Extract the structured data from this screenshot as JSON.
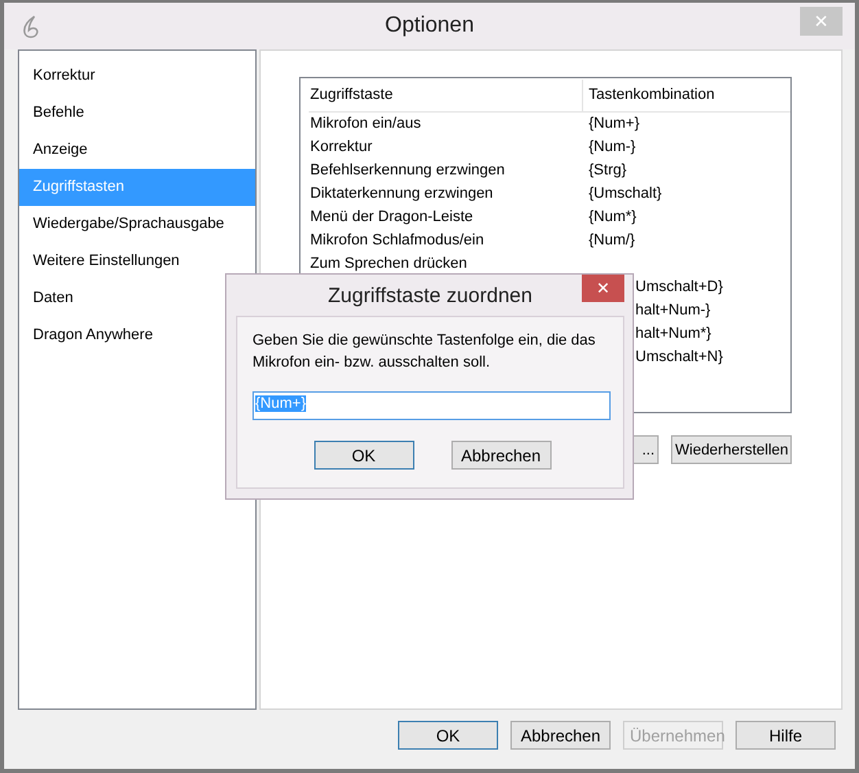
{
  "window": {
    "title": "Optionen",
    "close": "✕"
  },
  "sidebar": {
    "items": [
      {
        "label": "Korrektur",
        "selected": false
      },
      {
        "label": "Befehle",
        "selected": false
      },
      {
        "label": "Anzeige",
        "selected": false
      },
      {
        "label": "Zugriffstasten",
        "selected": true
      },
      {
        "label": "Wiedergabe/Sprachausgabe",
        "selected": false
      },
      {
        "label": "Weitere Einstellungen",
        "selected": false
      },
      {
        "label": "Daten",
        "selected": false
      },
      {
        "label": "Dragon Anywhere",
        "selected": false
      }
    ]
  },
  "table": {
    "columns": [
      "Zugriffstaste",
      "Tastenkombination"
    ],
    "rows": [
      {
        "action": "Mikrofon ein/aus",
        "key": "{Num+}"
      },
      {
        "action": "Korrektur",
        "key": "{Num-}"
      },
      {
        "action": "Befehlserkennung erzwingen",
        "key": "{Strg}"
      },
      {
        "action": "Diktaterkennung erzwingen",
        "key": "{Umschalt}"
      },
      {
        "action": "Menü der Dragon-Leiste",
        "key": "{Num*}"
      },
      {
        "action": "Mikrofon Schlafmodus/ein",
        "key": "{Num/}"
      },
      {
        "action": "Zum Sprechen drücken"
      },
      {
        "key": "Umschalt+D}"
      },
      {
        "key": "halt+Num-}"
      },
      {
        "key": "halt+Num*}"
      },
      {
        "key": "Umschalt+N}"
      }
    ]
  },
  "panel_buttons": [
    {
      "label": "..."
    },
    {
      "label": "Wiederherstellen"
    }
  ],
  "dialog": {
    "title": "Zugriffstaste zuordnen",
    "close": "✕",
    "message": "Geben Sie die gewünschte Tastenfolge ein, die das Mikrofon ein- bzw. ausschalten soll.",
    "value": "{Num+}",
    "buttons": [
      {
        "label": "OK",
        "default": true
      },
      {
        "label": "Abbrechen",
        "default": false
      }
    ]
  },
  "buttons": [
    {
      "label": "OK",
      "default": true,
      "disabled": false
    },
    {
      "label": "Abbrechen",
      "default": false,
      "disabled": false
    },
    {
      "label": "Übernehmen",
      "default": false,
      "disabled": true
    },
    {
      "label": "Hilfe",
      "default": false,
      "disabled": false
    }
  ]
}
